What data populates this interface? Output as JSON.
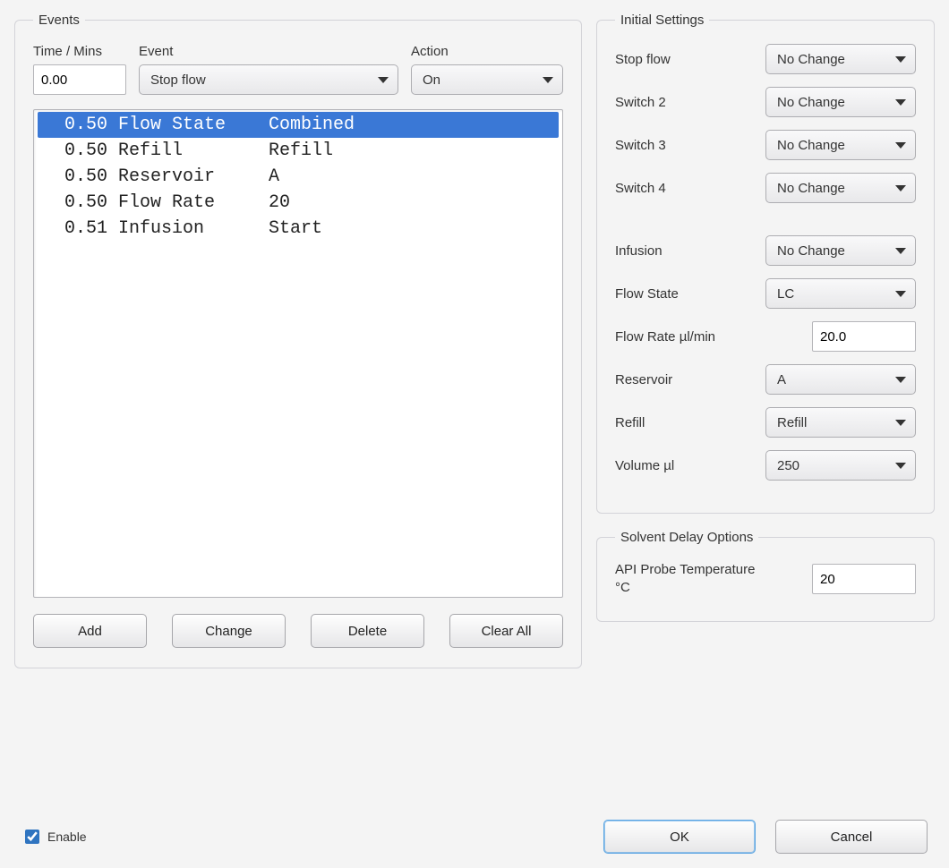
{
  "events_group": {
    "legend": "Events",
    "time_label": "Time / Mins",
    "event_label": "Event",
    "action_label": "Action",
    "time_value": "0.00",
    "event_value": "Stop flow",
    "action_value": "On",
    "rows": [
      {
        "time": "0.50",
        "event": "Flow State",
        "action": "Combined",
        "selected": true
      },
      {
        "time": "0.50",
        "event": "Refill",
        "action": "Refill",
        "selected": false
      },
      {
        "time": "0.50",
        "event": "Reservoir",
        "action": "A",
        "selected": false
      },
      {
        "time": "0.50",
        "event": "Flow Rate",
        "action": "20",
        "selected": false
      },
      {
        "time": "0.51",
        "event": "Infusion",
        "action": "Start",
        "selected": false
      }
    ],
    "buttons": {
      "add": "Add",
      "change": "Change",
      "delete": "Delete",
      "clear_all": "Clear All"
    }
  },
  "initial_settings": {
    "legend": "Initial Settings",
    "stop_flow": {
      "label": "Stop flow",
      "value": "No Change"
    },
    "switch2": {
      "label": "Switch 2",
      "value": "No Change"
    },
    "switch3": {
      "label": "Switch 3",
      "value": "No Change"
    },
    "switch4": {
      "label": "Switch 4",
      "value": "No Change"
    },
    "infusion": {
      "label": "Infusion",
      "value": "No Change"
    },
    "flow_state": {
      "label": "Flow State",
      "value": "LC"
    },
    "flow_rate": {
      "label": "Flow Rate µl/min",
      "value": "20.0"
    },
    "reservoir": {
      "label": "Reservoir",
      "value": "A"
    },
    "refill": {
      "label": "Refill",
      "value": "Refill"
    },
    "volume": {
      "label": "Volume µl",
      "value": "250"
    }
  },
  "solvent_delay": {
    "legend": "Solvent Delay Options",
    "api_probe_temp_label": "API Probe Temperature °C",
    "api_probe_temp_value": "20"
  },
  "footer": {
    "enable_label": "Enable",
    "enable_checked": true,
    "ok": "OK",
    "cancel": "Cancel"
  }
}
